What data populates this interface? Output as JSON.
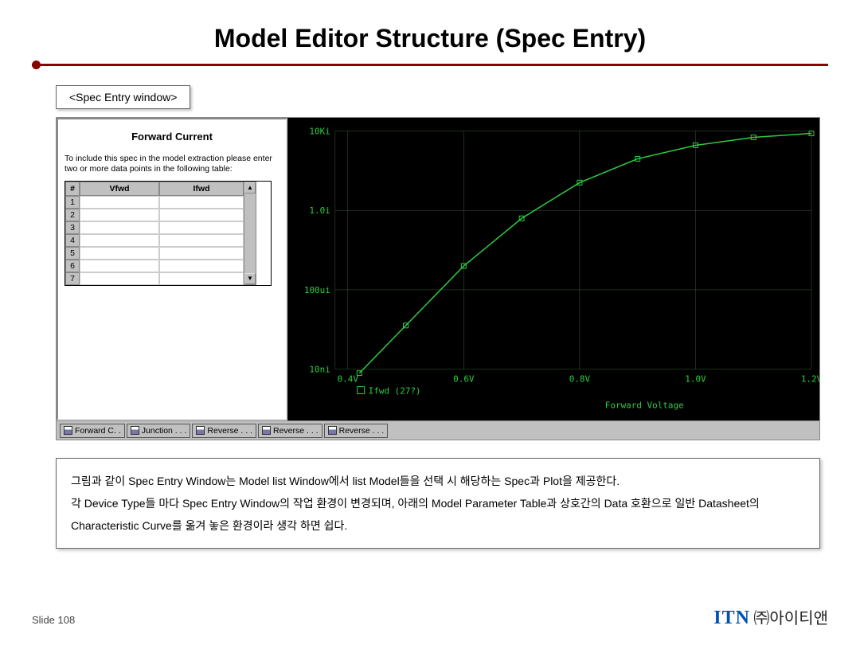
{
  "title": "Model Editor Structure (Spec Entry)",
  "caption": "<Spec Entry window>",
  "panel": {
    "heading": "Forward Current",
    "desc": "To include this spec in the model extraction please enter two or more data points in the following table:",
    "col1": "Vfwd",
    "col2": "Ifwd",
    "rows": [
      "1",
      "2",
      "3",
      "4",
      "5",
      "6",
      "7"
    ],
    "corner": "#"
  },
  "chart_data": {
    "type": "line",
    "title": "",
    "xlabel": "Forward Voltage",
    "ylabel": "",
    "x_ticks": [
      "0.4V",
      "0.6V",
      "0.8V",
      "1.0V",
      "1.2V"
    ],
    "y_ticks": [
      "10Ki",
      "1.0i",
      "100ui",
      "10ni"
    ],
    "legend": "Ifwd (27?)",
    "series": [
      {
        "name": "Ifwd",
        "points": [
          {
            "x": 0.42,
            "y_log_idx": 3.05
          },
          {
            "x": 0.5,
            "y_log_idx": 2.45
          },
          {
            "x": 0.6,
            "y_log_idx": 1.7
          },
          {
            "x": 0.7,
            "y_log_idx": 1.1
          },
          {
            "x": 0.8,
            "y_log_idx": 0.65
          },
          {
            "x": 0.9,
            "y_log_idx": 0.35
          },
          {
            "x": 1.0,
            "y_log_idx": 0.18
          },
          {
            "x": 1.1,
            "y_log_idx": 0.08
          },
          {
            "x": 1.2,
            "y_log_idx": 0.03
          }
        ]
      }
    ],
    "xlim": [
      0.38,
      1.22
    ]
  },
  "tabs": [
    "Forward C. .",
    "Junction . . .",
    "Reverse . . .",
    "Reverse . . .",
    "Reverse . . ."
  ],
  "description": {
    "p1": "그림과 같이 Spec Entry Window는 Model list Window에서 list Model들을 선택 시 해당하는 Spec과 Plot을 제공한다.",
    "p2": "각 Device Type들 마다 Spec Entry Window의 작업 환경이 변경되며, 아래의 Model Parameter Table과 상호간의 Data 호환으로 일반 Datasheet의 Characteristic Curve를 옮겨 놓은 환경이라 생각 하면 쉽다."
  },
  "footer": {
    "slide": "Slide 108",
    "brand_en": "ITN",
    "brand_ko": "㈜아이티앤"
  }
}
